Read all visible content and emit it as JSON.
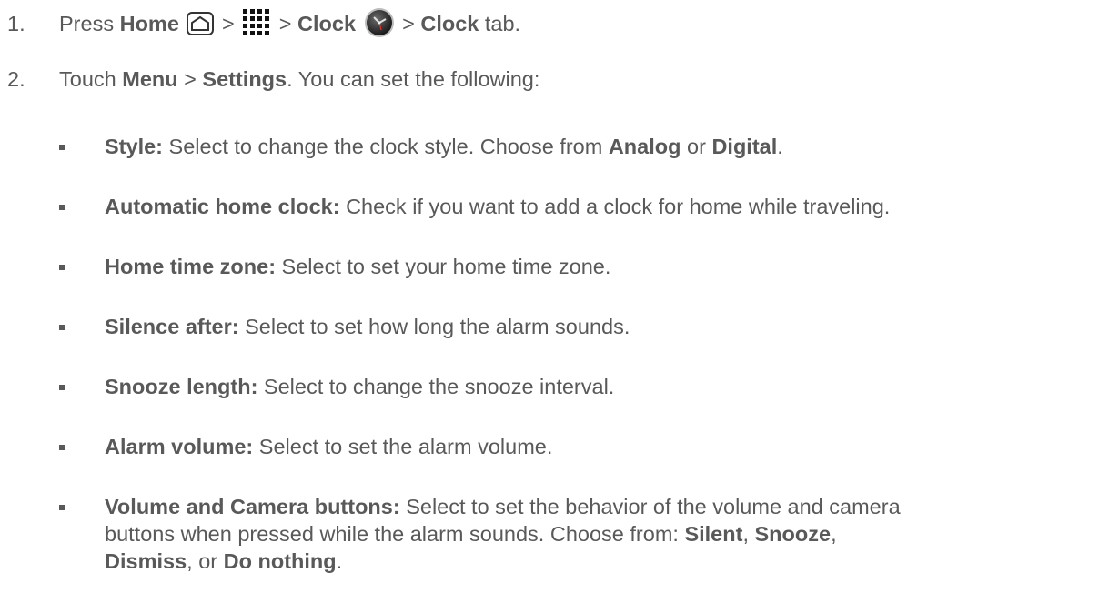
{
  "step1": {
    "number": "1.",
    "press": "Press ",
    "home": "Home",
    "sep1": " > ",
    "sep2": " > ",
    "clock": "Clock",
    "sep3": " > ",
    "clock_tab": "Clock",
    "tab": " tab."
  },
  "step2": {
    "number": "2.",
    "touch": "Touch ",
    "menu": "Menu",
    "sep": " > ",
    "settings": "Settings",
    "rest": ". You can set the following:"
  },
  "items": [
    {
      "term": "Style:",
      "text_before": " Select to change the clock style. Choose from ",
      "b1": "Analog",
      "mid": " or ",
      "b2": "Digital",
      "end": "."
    },
    {
      "term": "Automatic home clock:",
      "text": " Check if you want to add a clock for home while traveling."
    },
    {
      "term": "Home time zone:",
      "text": " Select to set your home time zone."
    },
    {
      "term": "Silence after:",
      "text": " Select to set how long the alarm sounds."
    },
    {
      "term": "Snooze length:",
      "text": " Select to change the snooze interval."
    },
    {
      "term": "Alarm volume:",
      "text": " Select to set the alarm volume."
    },
    {
      "term": "Volume and Camera buttons:",
      "line1": " Select to set the behavior of the volume and camera",
      "line2": "buttons when pressed while the alarm sounds. Choose from: ",
      "o1": "Silent",
      "c1": ", ",
      "o2": "Snooze",
      "c2": ",",
      "o3": "Dismiss",
      "c3": ", or ",
      "o4": "Do nothing",
      "end": "."
    }
  ]
}
